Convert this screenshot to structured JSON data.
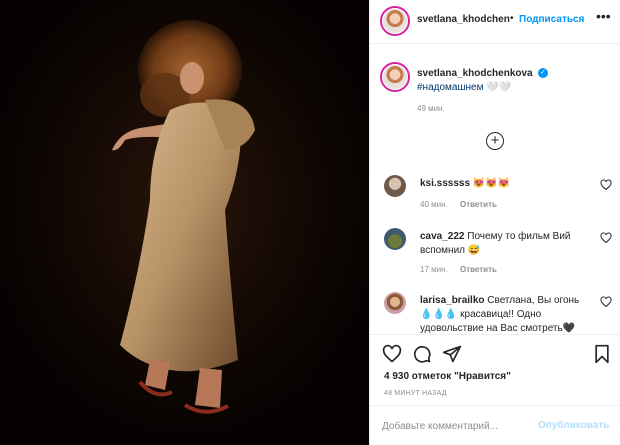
{
  "post": {
    "image_alt": "",
    "header": {
      "username": "svetlana_khodchen",
      "separator": "•",
      "follow_label": "Подписаться",
      "more_icon": "more-horizontal-icon"
    },
    "caption": {
      "username": "svetlana_khodchenkova",
      "verified": true,
      "text": "#надомашнем 🤍🤍",
      "time": "49 мин."
    },
    "load_more_icon": "plus-circle-icon",
    "comments": [
      {
        "username": "ksi.ssssss",
        "text": "😻😻😻",
        "time": "40 мин.",
        "reply": "Ответить"
      },
      {
        "username": "cava_222",
        "text": "Почему то фильм Вий вспомнил 😅",
        "time": "17 мин.",
        "reply": "Ответить"
      },
      {
        "username": "larisa_brailko",
        "text": "Светлана, Вы огонь💧💧💧 красавица!! Одно удовольствие на Вас смотреть🖤",
        "time": "",
        "reply": ""
      }
    ],
    "likes": "4 930 отметок \"Нравится\"",
    "posted_ago": "48 МИНУТ НАЗАД",
    "add_comment": {
      "placeholder": "Добавьте комментарий...",
      "submit_label": "Опубликовать"
    },
    "colors": {
      "accent": "#0095f6",
      "submit_disabled": "#b2dffc",
      "muted": "#8e8e8e",
      "text": "#262626"
    }
  }
}
